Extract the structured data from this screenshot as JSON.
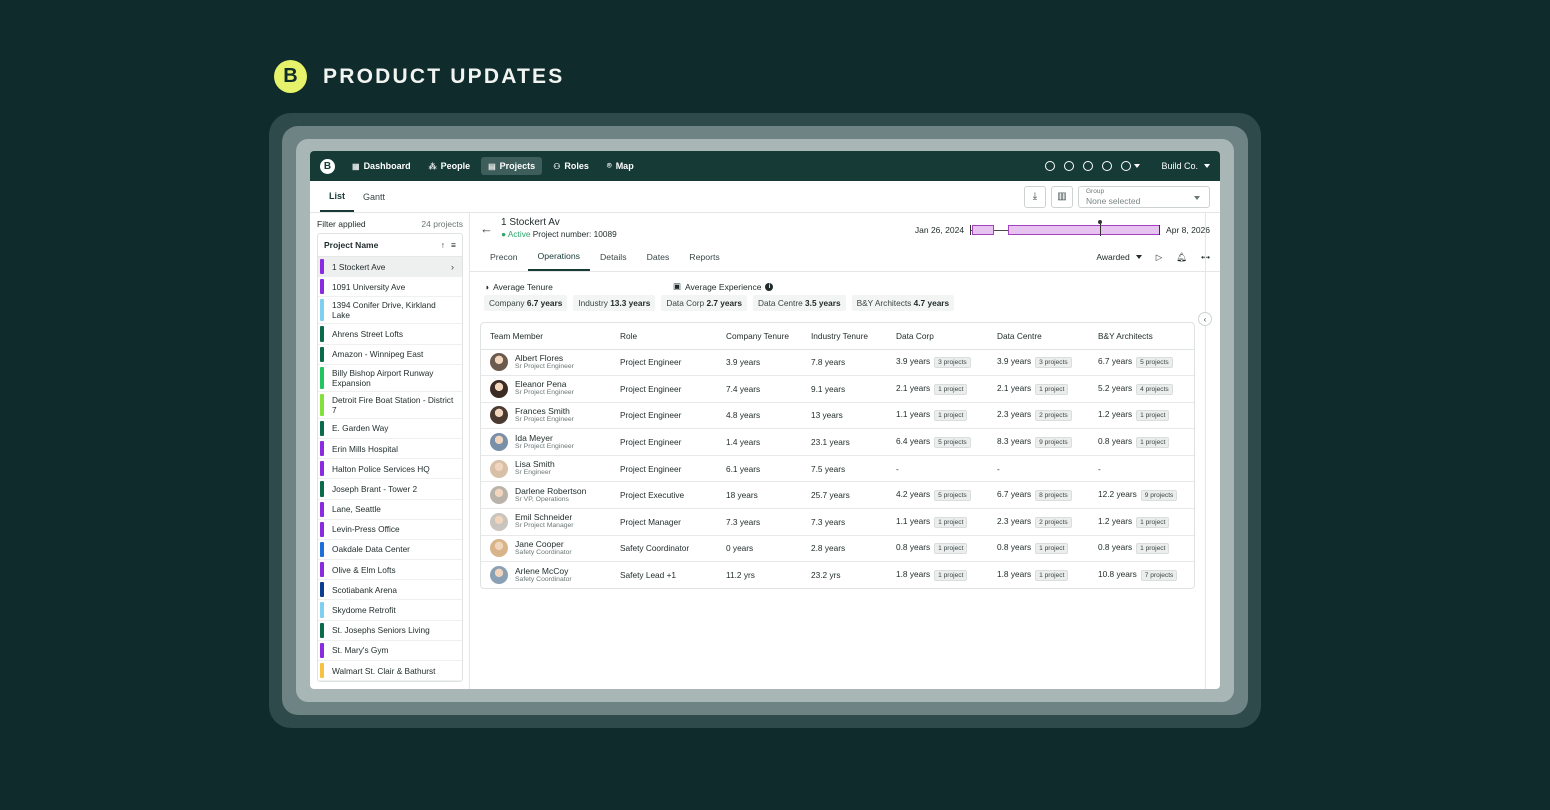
{
  "hero": {
    "logo_letter": "B",
    "title": "PRODUCT UPDATES"
  },
  "app": {
    "logo_letter": "B",
    "nav": [
      {
        "icon": "▦",
        "label": "Dashboard"
      },
      {
        "icon": "⁂",
        "label": "People"
      },
      {
        "icon": "▤",
        "label": "Projects"
      },
      {
        "icon": "⚇",
        "label": "Roles"
      },
      {
        "icon": "⌾",
        "label": "Map"
      }
    ],
    "company": "Build Co."
  },
  "subbar": {
    "tabs": [
      "List",
      "Gantt"
    ],
    "group_label": "Group",
    "group_value": "None selected"
  },
  "sidebar": {
    "filter_label": "Filter applied",
    "count_label": "24 projects",
    "header": "Project Name",
    "projects": [
      {
        "name": "1 Stockert Ave",
        "color": "#8a2be2"
      },
      {
        "name": "1091 University Ave",
        "color": "#8a2be2"
      },
      {
        "name": "1394 Conifer Drive, Kirkland Lake",
        "color": "#7fd0f0"
      },
      {
        "name": "Ahrens Street Lofts",
        "color": "#0d6b4d"
      },
      {
        "name": "Amazon - Winnipeg East",
        "color": "#0d6b4d"
      },
      {
        "name": "Billy Bishop Airport Runway Expansion",
        "color": "#22c55e"
      },
      {
        "name": "Detroit Fire Boat Station - District 7",
        "color": "#84e03a"
      },
      {
        "name": "E. Garden Way",
        "color": "#0d6b4d"
      },
      {
        "name": "Erin Mills Hospital",
        "color": "#8a2be2"
      },
      {
        "name": "Halton Police Services HQ",
        "color": "#8a2be2"
      },
      {
        "name": "Joseph Brant - Tower 2",
        "color": "#0d6b4d"
      },
      {
        "name": "Lane, Seattle",
        "color": "#8a2be2"
      },
      {
        "name": "Levin-Press Office",
        "color": "#8a2be2"
      },
      {
        "name": "Oakdale Data Center",
        "color": "#1e6fd9"
      },
      {
        "name": "Olive & Elm Lofts",
        "color": "#8a2be2"
      },
      {
        "name": "Scotiabank Arena",
        "color": "#0b3d91"
      },
      {
        "name": "Skydome Retrofit",
        "color": "#7fd0f0"
      },
      {
        "name": "St. Josephs Seniors Living",
        "color": "#0d6b4d"
      },
      {
        "name": "St. Mary's Gym",
        "color": "#8a2be2"
      },
      {
        "name": "Walmart St. Clair & Bathurst",
        "color": "#f5c242"
      }
    ]
  },
  "project": {
    "title": "1 Stockert Av",
    "status": "● Active",
    "number": "Project number: 10089",
    "start": "Jan 26, 2024",
    "end": "Apr 8, 2026",
    "tabs": [
      "Precon",
      "Operations",
      "Details",
      "Dates",
      "Reports"
    ],
    "stage": "Awarded"
  },
  "summary": {
    "tenure_title": "Average Tenure",
    "experience_title": "Average Experience",
    "tenure_chips": [
      {
        "label": "Company",
        "value": "6.7 years"
      },
      {
        "label": "Industry",
        "value": "13.3 years"
      }
    ],
    "experience_chips": [
      {
        "label": "Data Corp",
        "value": "2.7 years"
      },
      {
        "label": "Data Centre",
        "value": "3.5 years"
      },
      {
        "label": "B&Y Architects",
        "value": "4.7 years"
      }
    ]
  },
  "table": {
    "columns": [
      "Team Member",
      "Role",
      "Company Tenure",
      "Industry Tenure",
      "Data Corp",
      "Data Centre",
      "B&Y Architects"
    ],
    "rows": [
      {
        "name": "Albert Flores",
        "title": "Sr Project Engineer",
        "avatar": "#6b5a4e",
        "role": "Project Engineer",
        "company": "3.9 years",
        "industry": "7.8 years",
        "dc": "3.9 years",
        "dc_p": "3 projects",
        "dcen": "3.9 years",
        "dcen_p": "3 projects",
        "by": "6.7 years",
        "by_p": "5 projects"
      },
      {
        "name": "Eleanor Pena",
        "title": "Sr Project Engineer",
        "avatar": "#3b2b24",
        "role": "Project Engineer",
        "company": "7.4 years",
        "industry": "9.1 years",
        "dc": "2.1 years",
        "dc_p": "1 project",
        "dcen": "2.1 years",
        "dcen_p": "1 project",
        "by": "5.2 years",
        "by_p": "4 projects"
      },
      {
        "name": "Frances Smith",
        "title": "Sr Project Engineer",
        "avatar": "#4a3a30",
        "role": "Project Engineer",
        "company": "4.8 years",
        "industry": "13 years",
        "dc": "1.1 years",
        "dc_p": "1 project",
        "dcen": "2.3 years",
        "dcen_p": "2 projects",
        "by": "1.2 years",
        "by_p": "1 project"
      },
      {
        "name": "Ida Meyer",
        "title": "Sr Project Engineer",
        "avatar": "#7a8fa8",
        "role": "Project Engineer",
        "company": "1.4 years",
        "industry": "23.1 years",
        "dc": "6.4 years",
        "dc_p": "5 projects",
        "dcen": "8.3 years",
        "dcen_p": "9 projects",
        "by": "0.8 years",
        "by_p": "1 project"
      },
      {
        "name": "Lisa Smith",
        "title": "Sr Engineer",
        "avatar": "#d8c0a8",
        "role": "Project Engineer",
        "company": "6.1 years",
        "industry": "7.5 years",
        "dc": "-",
        "dc_p": "",
        "dcen": "-",
        "dcen_p": "",
        "by": "-",
        "by_p": ""
      },
      {
        "name": "Darlene Robertson",
        "title": "Sr VP, Operations",
        "avatar": "#b9b3aa",
        "role": "Project Executive",
        "company": "18 years",
        "industry": "25.7 years",
        "dc": "4.2 years",
        "dc_p": "5 projects",
        "dcen": "6.7 years",
        "dcen_p": "8 projects",
        "by": "12.2 years",
        "by_p": "9 projects"
      },
      {
        "name": "Emil Schneider",
        "title": "Sr Project Manager",
        "avatar": "#c9c4bd",
        "role": "Project Manager",
        "company": "7.3 years",
        "industry": "7.3 years",
        "dc": "1.1 years",
        "dc_p": "1 project",
        "dcen": "2.3 years",
        "dcen_p": "2 projects",
        "by": "1.2 years",
        "by_p": "1 project"
      },
      {
        "name": "Jane Cooper",
        "title": "Safety Coordinator",
        "avatar": "#d9b48a",
        "role": "Safety Coordinator",
        "company": "0 years",
        "industry": "2.8 years",
        "dc": "0.8 years",
        "dc_p": "1 project",
        "dcen": "0.8 years",
        "dcen_p": "1 project",
        "by": "0.8 years",
        "by_p": "1 project"
      },
      {
        "name": "Arlene McCoy",
        "title": "Safety Coordinator",
        "avatar": "#8aa0b4",
        "role": "Safety Lead +1",
        "company": "11.2 yrs",
        "industry": "23.2 yrs",
        "dc": "1.8 years",
        "dc_p": "1 project",
        "dcen": "1.8 years",
        "dcen_p": "1 project",
        "by": "10.8 years",
        "by_p": "7 projects"
      }
    ]
  }
}
